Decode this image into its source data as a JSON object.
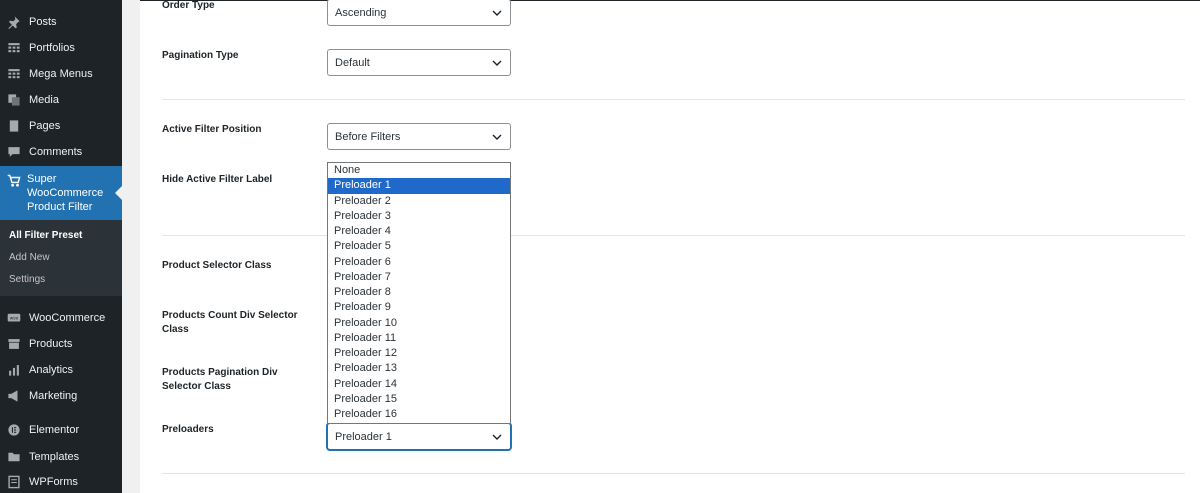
{
  "sidebar": {
    "items_top": [
      {
        "label": "Posts",
        "icon": "pin-icon"
      },
      {
        "label": "Portfolios",
        "icon": "grid-icon"
      },
      {
        "label": "Mega Menus",
        "icon": "grid-icon"
      },
      {
        "label": "Media",
        "icon": "media-icon"
      },
      {
        "label": "Pages",
        "icon": "pages-icon"
      },
      {
        "label": "Comments",
        "icon": "comment-icon"
      }
    ],
    "active": {
      "label": "Super WooCommerce Product Filter",
      "icon": "cart-icon"
    },
    "submenu": [
      "All Filter Preset",
      "Add New",
      "Settings"
    ],
    "items_bottom": [
      {
        "label": "WooCommerce",
        "icon": "woo-icon"
      },
      {
        "label": "Products",
        "icon": "archive-icon"
      },
      {
        "label": "Analytics",
        "icon": "chart-icon"
      },
      {
        "label": "Marketing",
        "icon": "megaphone-icon"
      },
      {
        "label": "Elementor",
        "icon": "elementor-icon"
      },
      {
        "label": "Templates",
        "icon": "folder-icon"
      },
      {
        "label": "WPForms",
        "icon": "form-icon"
      }
    ]
  },
  "settings": {
    "order_type": {
      "label": "Order Type",
      "value": "Ascending"
    },
    "pagination_type": {
      "label": "Pagination Type",
      "value": "Default"
    },
    "active_filter_position": {
      "label": "Active Filter Position",
      "value": "Before Filters"
    },
    "hide_active_filter_label": {
      "label": "Hide Active Filter Label"
    },
    "product_selector_class": {
      "label": "Product Selector Class"
    },
    "products_count_div": {
      "label": "Products Count Div Selector Class"
    },
    "products_pagination_div": {
      "label": "Products Pagination Div Selector Class"
    },
    "preloaders": {
      "label": "Preloaders",
      "value": "Preloader 1"
    }
  },
  "dropdown_options": [
    "None",
    "Preloader 1",
    "Preloader 2",
    "Preloader 3",
    "Preloader 4",
    "Preloader 5",
    "Preloader 6",
    "Preloader 7",
    "Preloader 8",
    "Preloader 9",
    "Preloader 10",
    "Preloader 11",
    "Preloader 12",
    "Preloader 13",
    "Preloader 14",
    "Preloader 15",
    "Preloader 16"
  ],
  "dropdown_selected_index": 1,
  "colors": {
    "sidebar_bg": "#1d2327",
    "accent": "#2271b1",
    "highlight": "#1e69c9"
  }
}
